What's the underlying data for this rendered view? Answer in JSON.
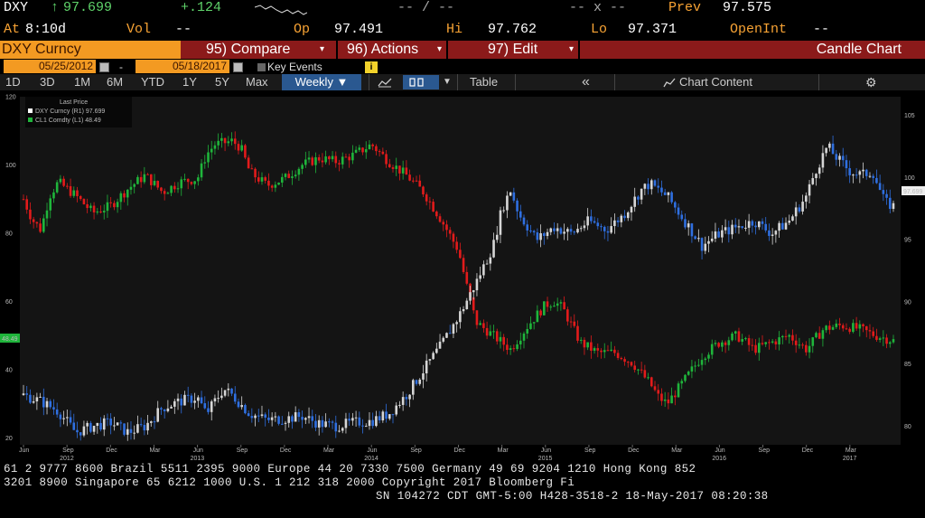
{
  "quote": {
    "symbol": "DXY",
    "arrow": "↑",
    "last": "97.699",
    "change": "+.124",
    "time_label": "At",
    "time": "8:10d",
    "vol_label": "Vol",
    "vol": "--",
    "bid_ask": "-- / --",
    "bid_ask2": "-- x --",
    "op_label": "Op",
    "op": "97.491",
    "hi_label": "Hi",
    "hi": "97.762",
    "lo_label": "Lo",
    "lo": "97.371",
    "prev_label": "Prev",
    "prev": "97.575",
    "openint_label": "OpenInt",
    "openint": "--"
  },
  "cmdbar": {
    "ticker": "DXY Curncy",
    "compare": "95) Compare",
    "actions": "96) Actions",
    "edit": "97) Edit",
    "title": "Candle Chart"
  },
  "daterow": {
    "start": "05/25/2012",
    "dash": "-",
    "end": "05/18/2017",
    "key_events": "Key Events",
    "info": "i"
  },
  "toolbar": {
    "ranges": [
      "1D",
      "3D",
      "1M",
      "6M",
      "YTD",
      "1Y",
      "5Y",
      "Max"
    ],
    "period": "Weekly ▼",
    "table": "Table",
    "collapse": "«",
    "chart_content": "Chart Content",
    "settings_icon": "gear-icon",
    "line_icon": "line-chart-icon",
    "compare_icon": "candle-style-icon"
  },
  "colors": {
    "dxy_line": "#2f6fe0",
    "dxy_up": "#d6d6d6",
    "cl1_up": "#1fb53b",
    "cl1_down": "#e21b1b",
    "orange": "#f39a22",
    "red_bar": "#8b1a1a"
  },
  "chart_data": {
    "type": "candlestick",
    "legend_title": "Last Price",
    "legend": [
      {
        "name": "DXY Curncy  (R1) 97.699",
        "color": "#ffffff"
      },
      {
        "name": "CL1 Comdty  (L1) 48.49",
        "color": "#1fb53b"
      }
    ],
    "left_axis": {
      "ticks": [
        20,
        40,
        60,
        80,
        100,
        120
      ],
      "range": [
        18,
        120
      ]
    },
    "right_axis": {
      "ticks": [
        80,
        85,
        90,
        95,
        100,
        105
      ],
      "range": [
        78.5,
        106.5
      ]
    },
    "left_last_label": "48.49",
    "right_last_label": "97.699",
    "x_ticks": [
      "Jun",
      "Sep",
      "Dec",
      "Mar",
      "Jun",
      "Sep",
      "Dec",
      "Mar",
      "Jun",
      "Sep",
      "Dec",
      "Mar",
      "Jun",
      "Sep",
      "Dec",
      "Mar",
      "Jun",
      "Sep",
      "Dec",
      "Mar"
    ],
    "x_ticks_t": [
      0.0,
      0.25,
      0.5,
      0.75,
      1.0,
      1.25,
      1.5,
      1.75,
      2.0,
      2.25,
      2.5,
      2.75,
      3.0,
      3.25,
      3.5,
      3.75,
      4.0,
      4.25,
      4.5,
      4.75
    ],
    "years": [
      {
        "label": "2012",
        "t": 0.25
      },
      {
        "label": "2013",
        "t": 1.0
      },
      {
        "label": "2014",
        "t": 2.0
      },
      {
        "label": "2015",
        "t": 3.0
      },
      {
        "label": "2016",
        "t": 4.0
      },
      {
        "label": "2017",
        "t": 4.75
      }
    ],
    "series": [
      {
        "name": "DXY Curncy",
        "axis": "right",
        "points": [
          [
            0,
            82.5
          ],
          [
            0.1,
            82
          ],
          [
            0.2,
            81.2
          ],
          [
            0.3,
            79.5
          ],
          [
            0.4,
            80
          ],
          [
            0.5,
            80.3
          ],
          [
            0.6,
            79.5
          ],
          [
            0.7,
            80
          ],
          [
            0.8,
            81.5
          ],
          [
            0.9,
            82
          ],
          [
            1.0,
            82.3
          ],
          [
            1.05,
            81
          ],
          [
            1.15,
            83
          ],
          [
            1.2,
            82.5
          ],
          [
            1.3,
            81
          ],
          [
            1.4,
            80.5
          ],
          [
            1.5,
            80.6
          ],
          [
            1.6,
            80.8
          ],
          [
            1.7,
            80.2
          ],
          [
            1.8,
            80
          ],
          [
            1.9,
            80.3
          ],
          [
            2.0,
            80.4
          ],
          [
            2.1,
            81
          ],
          [
            2.2,
            82.5
          ],
          [
            2.3,
            84.5
          ],
          [
            2.4,
            86.5
          ],
          [
            2.5,
            88.8
          ],
          [
            2.6,
            91.5
          ],
          [
            2.7,
            94.5
          ],
          [
            2.75,
            97.5
          ],
          [
            2.8,
            99
          ],
          [
            2.85,
            97
          ],
          [
            2.95,
            95
          ],
          [
            3.05,
            96
          ],
          [
            3.15,
            95.5
          ],
          [
            3.25,
            96.5
          ],
          [
            3.35,
            95.8
          ],
          [
            3.45,
            97
          ],
          [
            3.55,
            99
          ],
          [
            3.6,
            99.5
          ],
          [
            3.7,
            98.5
          ],
          [
            3.8,
            96.5
          ],
          [
            3.9,
            94.5
          ],
          [
            4.0,
            95.5
          ],
          [
            4.1,
            96
          ],
          [
            4.2,
            96.5
          ],
          [
            4.3,
            95.5
          ],
          [
            4.4,
            96.5
          ],
          [
            4.5,
            98.5
          ],
          [
            4.55,
            100.5
          ],
          [
            4.62,
            102.5
          ],
          [
            4.68,
            101.5
          ],
          [
            4.75,
            100.5
          ],
          [
            4.82,
            100.2
          ],
          [
            4.88,
            100.5
          ],
          [
            4.95,
            98
          ],
          [
            5.0,
            97.7
          ]
        ]
      },
      {
        "name": "CL1 Comdty",
        "axis": "left",
        "points": [
          [
            0,
            90
          ],
          [
            0.05,
            84
          ],
          [
            0.1,
            81
          ],
          [
            0.15,
            91
          ],
          [
            0.2,
            95
          ],
          [
            0.3,
            91
          ],
          [
            0.4,
            86
          ],
          [
            0.5,
            88
          ],
          [
            0.6,
            93
          ],
          [
            0.7,
            97
          ],
          [
            0.8,
            92
          ],
          [
            0.9,
            95
          ],
          [
            1.0,
            96
          ],
          [
            1.05,
            103
          ],
          [
            1.1,
            106
          ],
          [
            1.2,
            107
          ],
          [
            1.25,
            105
          ],
          [
            1.3,
            98
          ],
          [
            1.4,
            94
          ],
          [
            1.5,
            96
          ],
          [
            1.6,
            100
          ],
          [
            1.7,
            102
          ],
          [
            1.8,
            101
          ],
          [
            1.9,
            103
          ],
          [
            2.0,
            106
          ],
          [
            2.1,
            101
          ],
          [
            2.2,
            97
          ],
          [
            2.3,
            92
          ],
          [
            2.4,
            84
          ],
          [
            2.5,
            75
          ],
          [
            2.55,
            64
          ],
          [
            2.6,
            54
          ],
          [
            2.7,
            50
          ],
          [
            2.8,
            46
          ],
          [
            2.9,
            53
          ],
          [
            3.0,
            59
          ],
          [
            3.05,
            60
          ],
          [
            3.1,
            58
          ],
          [
            3.2,
            48
          ],
          [
            3.3,
            45
          ],
          [
            3.4,
            45
          ],
          [
            3.5,
            42
          ],
          [
            3.6,
            36
          ],
          [
            3.65,
            32
          ],
          [
            3.7,
            30
          ],
          [
            3.8,
            37
          ],
          [
            3.9,
            44
          ],
          [
            4.0,
            48
          ],
          [
            4.1,
            50
          ],
          [
            4.2,
            46
          ],
          [
            4.3,
            48
          ],
          [
            4.4,
            50
          ],
          [
            4.5,
            46
          ],
          [
            4.6,
            52
          ],
          [
            4.7,
            53
          ],
          [
            4.8,
            52
          ],
          [
            4.9,
            50
          ],
          [
            5.0,
            48.5
          ]
        ]
      }
    ]
  },
  "footer": {
    "line1": "61 2 9777 8600 Brazil 5511 2395 9000 Europe 44 20 7330 7500 Germany 49 69 9204 1210 Hong Kong 852",
    "line2": "3201 8900        Singapore 65 6212 1000      U.S. 1 212 318 2000       Copyright 2017 Bloomberg Fi",
    "line3": "SN 104272 CDT  GMT-5:00 H428-3518-2 18-May-2017 08:20:38"
  }
}
